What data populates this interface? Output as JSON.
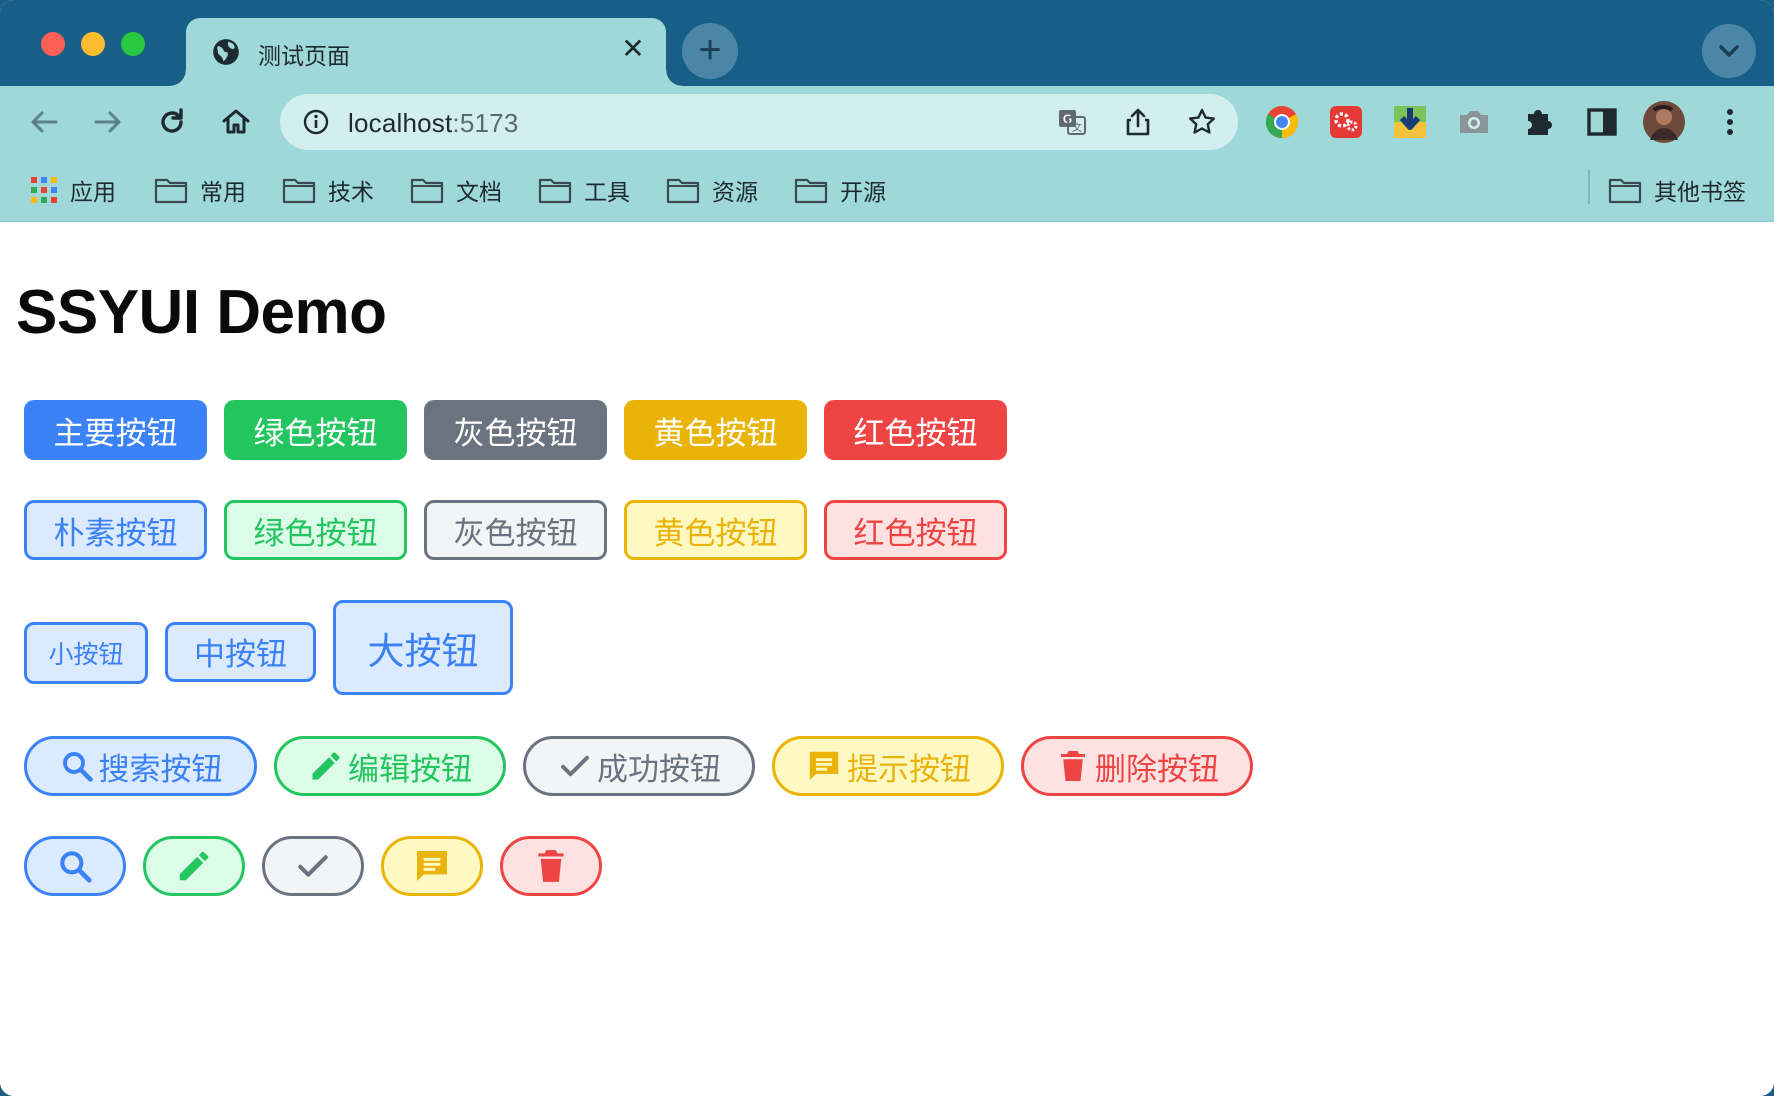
{
  "browser": {
    "tab_title": "测试页面",
    "tab_close": "✕",
    "new_tab": "+",
    "url_host": "localhost",
    "url_port": ":5173"
  },
  "bookmarks": {
    "apps_label": "应用",
    "folders": [
      "常用",
      "技术",
      "文档",
      "工具",
      "资源",
      "开源"
    ],
    "other_label": "其他书签"
  },
  "page": {
    "title": "SSYUI Demo",
    "solid_buttons": [
      "主要按钮",
      "绿色按钮",
      "灰色按钮",
      "黄色按钮",
      "红色按钮"
    ],
    "plain_buttons": [
      "朴素按钮",
      "绿色按钮",
      "灰色按钮",
      "黄色按钮",
      "红色按钮"
    ],
    "size_buttons": [
      "小按钮",
      "中按钮",
      "大按钮"
    ],
    "icon_buttons": [
      {
        "label": "搜索按钮",
        "icon": "search-icon"
      },
      {
        "label": "编辑按钮",
        "icon": "pencil-icon"
      },
      {
        "label": "成功按钮",
        "icon": "check-icon"
      },
      {
        "label": "提示按钮",
        "icon": "message-icon"
      },
      {
        "label": "删除按钮",
        "icon": "trash-icon"
      }
    ],
    "icon_only_buttons": [
      "search-icon",
      "pencil-icon",
      "check-icon",
      "message-icon",
      "trash-icon"
    ]
  },
  "colors": {
    "primary": "#3b82f6",
    "success": "#22c55e",
    "info": "#6b7280",
    "warning": "#eab308",
    "danger": "#ef4444"
  }
}
